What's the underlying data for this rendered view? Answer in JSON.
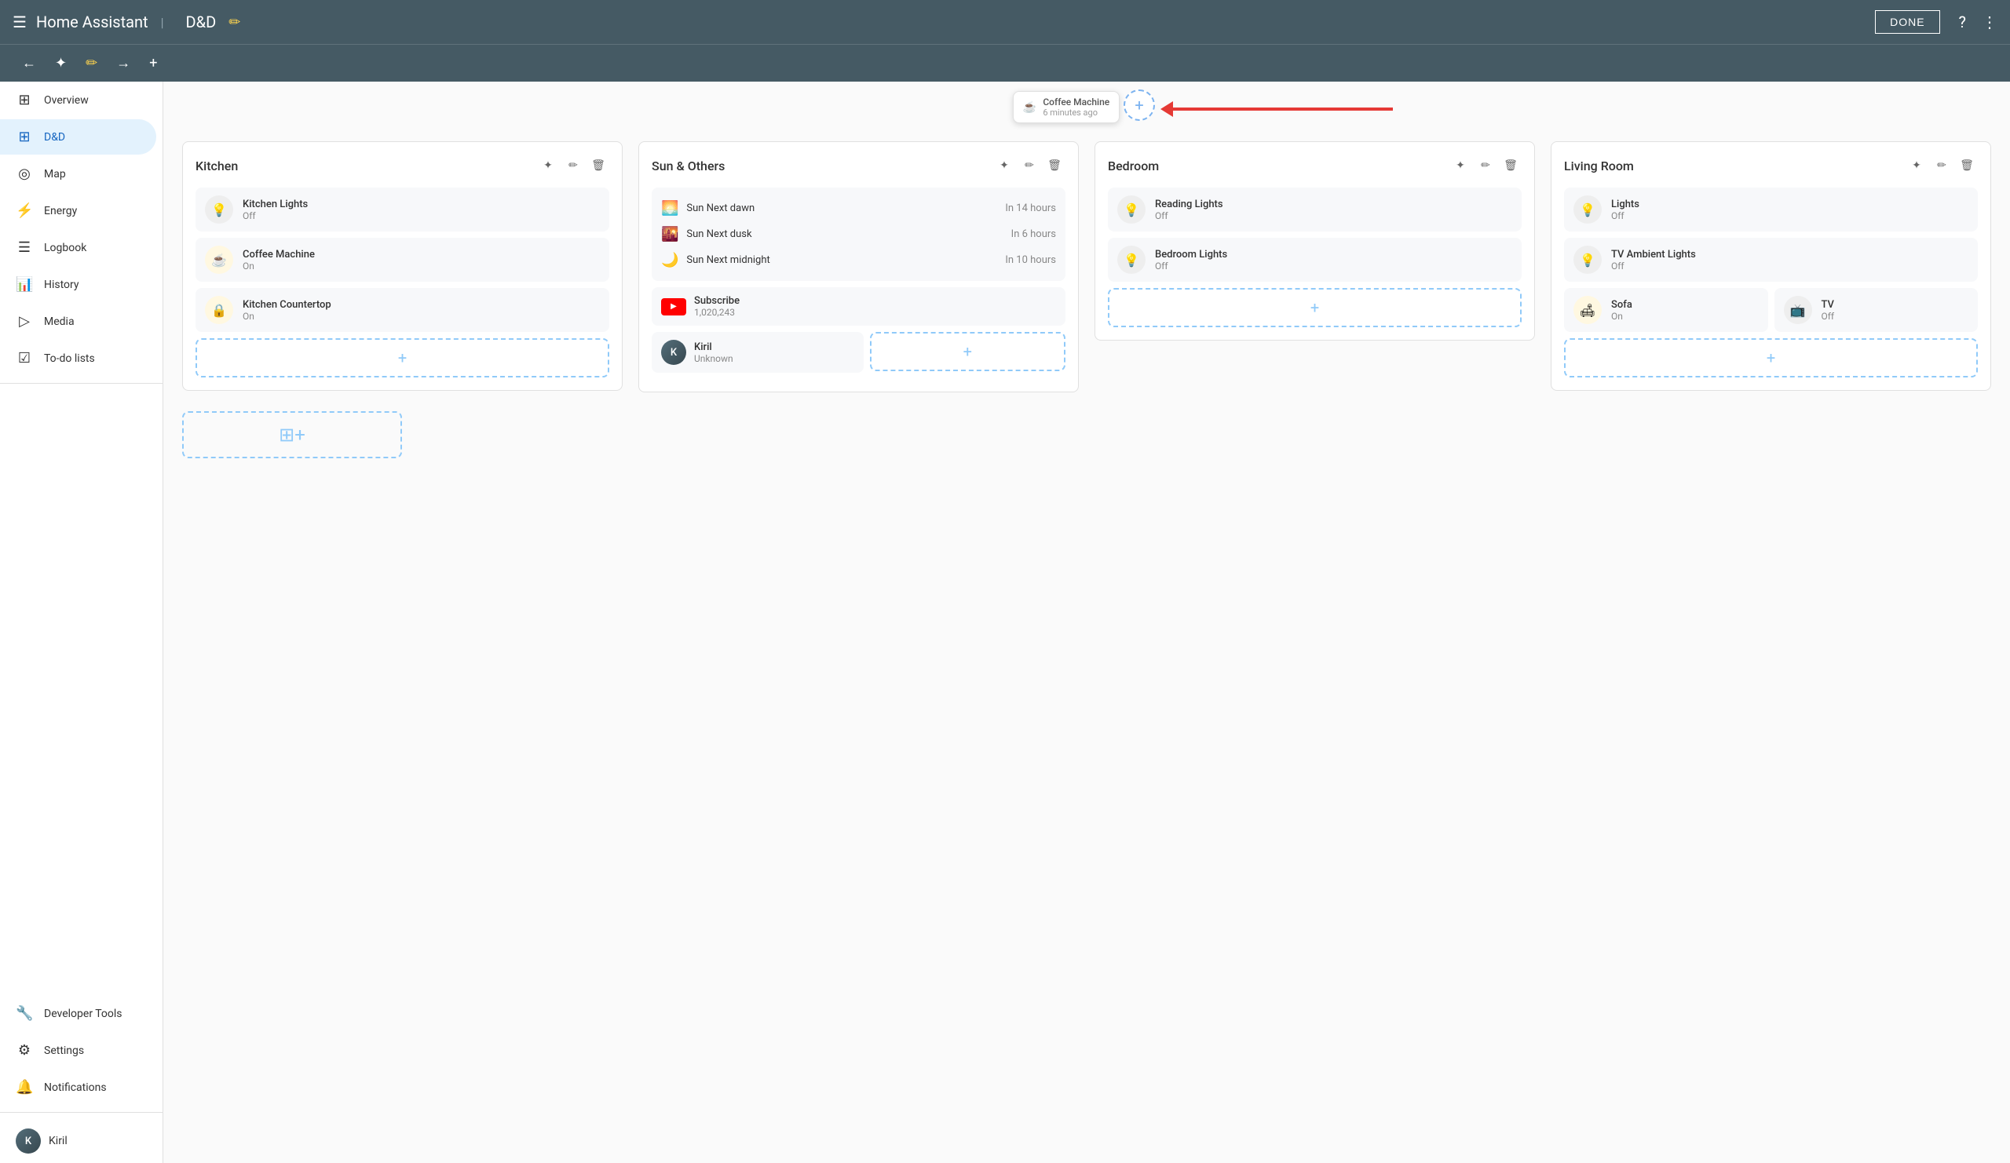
{
  "app": {
    "title": "Home Assistant",
    "page_title": "D&D",
    "done_label": "DONE"
  },
  "sidebar": {
    "items": [
      {
        "id": "overview",
        "label": "Overview",
        "icon": "⊞"
      },
      {
        "id": "dnd",
        "label": "D&D",
        "icon": "⊞",
        "active": true
      },
      {
        "id": "map",
        "label": "Map",
        "icon": "◎"
      },
      {
        "id": "energy",
        "label": "Energy",
        "icon": "⚡"
      },
      {
        "id": "logbook",
        "label": "Logbook",
        "icon": "☰"
      },
      {
        "id": "history",
        "label": "History",
        "icon": "📊"
      },
      {
        "id": "media",
        "label": "Media",
        "icon": "▷"
      },
      {
        "id": "todo",
        "label": "To-do lists",
        "icon": "☑"
      }
    ],
    "bottom_items": [
      {
        "id": "dev-tools",
        "label": "Developer Tools",
        "icon": "🔧"
      },
      {
        "id": "settings",
        "label": "Settings",
        "icon": "⚙"
      },
      {
        "id": "notifications",
        "label": "Notifications",
        "icon": "🔔"
      }
    ],
    "user": {
      "name": "Kiril",
      "initials": "K"
    }
  },
  "notification": {
    "entity": "Coffee Machine",
    "time": "6 minutes ago"
  },
  "columns": [
    {
      "id": "kitchen",
      "title": "Kitchen",
      "entities": [
        {
          "name": "Kitchen Lights",
          "state": "Off",
          "icon": "💡",
          "icon_color": "gray"
        },
        {
          "name": "Coffee Machine",
          "state": "On",
          "icon": "☕",
          "icon_color": "amber"
        },
        {
          "name": "Kitchen Countertop",
          "state": "On",
          "icon": "🔒",
          "icon_color": "amber"
        }
      ]
    },
    {
      "id": "sun-others",
      "title": "Sun & Others",
      "sun_items": [
        {
          "name": "Sun Next dawn",
          "value": "In 14 hours"
        },
        {
          "name": "Sun Next dusk",
          "value": "In 6 hours"
        },
        {
          "name": "Sun Next midnight",
          "value": "In 10 hours"
        }
      ],
      "extra_entities": [
        {
          "name": "Subscribe",
          "state": "1,020,243",
          "type": "youtube"
        },
        {
          "name": "Kiril",
          "state": "Unknown",
          "type": "profile"
        }
      ]
    },
    {
      "id": "bedroom",
      "title": "Bedroom",
      "entities": [
        {
          "name": "Reading Lights",
          "state": "Off",
          "icon": "💡",
          "icon_color": "gray"
        },
        {
          "name": "Bedroom Lights",
          "state": "Off",
          "icon": "💡",
          "icon_color": "gray"
        }
      ]
    },
    {
      "id": "living-room",
      "title": "Living Room",
      "entities": [
        {
          "name": "Lights",
          "state": "Off",
          "icon": "💡",
          "icon_color": "gray"
        },
        {
          "name": "TV Ambient Lights",
          "state": "Off",
          "icon": "💡",
          "icon_color": "gray"
        },
        {
          "name": "Sofa",
          "state": "On",
          "icon": "🛋",
          "icon_color": "amber"
        },
        {
          "name": "TV",
          "state": "Off",
          "icon": "📺",
          "icon_color": "gray"
        }
      ]
    }
  ],
  "add_label": "+",
  "add_section_icon": "⊞"
}
